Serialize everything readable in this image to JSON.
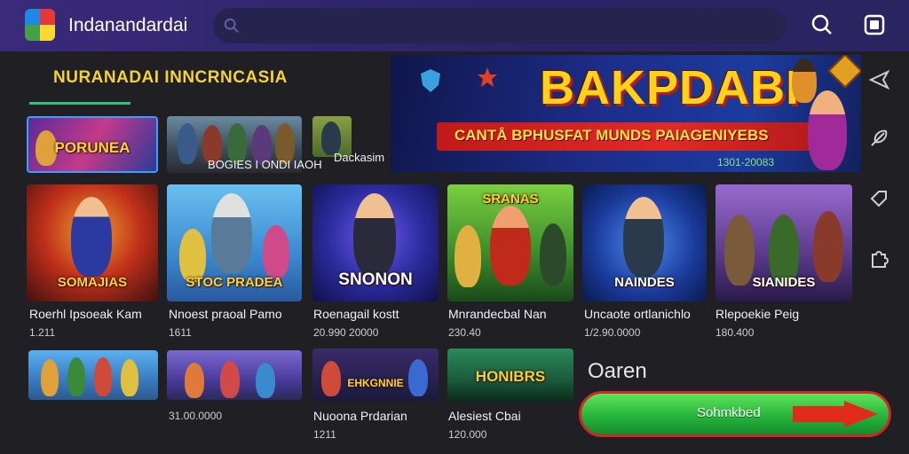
{
  "header": {
    "title": "Indanandardai",
    "search_placeholder": "",
    "icons": [
      "app-logo",
      "search-icon",
      "window-icon"
    ]
  },
  "section": {
    "heading": "NURANADAI INNCRNCASIA"
  },
  "featured": {
    "tiles": [
      {
        "label": "PORUNEA"
      },
      {
        "label": ""
      },
      {
        "label": ""
      }
    ],
    "caption": "BOGIES I ONDI IAOH",
    "caption2": "Dackasim"
  },
  "banner": {
    "title": "BAKPDABI",
    "subtitle": "CANTÅ BPHUSFAT MUNDS PAIAGENIYEBS",
    "date": "1301-20083"
  },
  "games_row1": [
    {
      "name": "Roerhl Ipsoeak Kam",
      "meta": "1.211",
      "tag": "SOMAJIAS"
    },
    {
      "name": "Nnoest praoal Pamo",
      "meta": "1611",
      "tag": "STOC PRADEA"
    },
    {
      "name": "Roenagail kostt",
      "meta": "20.990 20000",
      "tag": "SNONON"
    },
    {
      "name": "Mnrandecbal Nan",
      "meta": "230.40",
      "tag": "SRANAS"
    },
    {
      "name": "Uncaote ortlanichlo",
      "meta": "1/2.90.0000",
      "tag": "NAINDES"
    },
    {
      "name": "Rlepoekie Peig",
      "meta": "180.400",
      "tag": "SIANIDES"
    }
  ],
  "games_row2": [
    {
      "name": "",
      "meta": "",
      "tag": ""
    },
    {
      "name": "",
      "meta": "31.00.0000",
      "tag": ""
    },
    {
      "name": "Nuoona Prdarian",
      "meta": "1211",
      "tag": "EHKGNNIE"
    },
    {
      "name": "Alesiest Cbai",
      "meta": "120.000",
      "tag": "HONIBRS"
    }
  ],
  "side": {
    "label": "Oaren",
    "button": "Sohmkbed"
  },
  "colors": {
    "accent": "#2ec27e",
    "header": "#2b2366",
    "cta_green": "#23b03a",
    "cta_border": "#d02626",
    "heading_yellow": "#f3d23a"
  }
}
